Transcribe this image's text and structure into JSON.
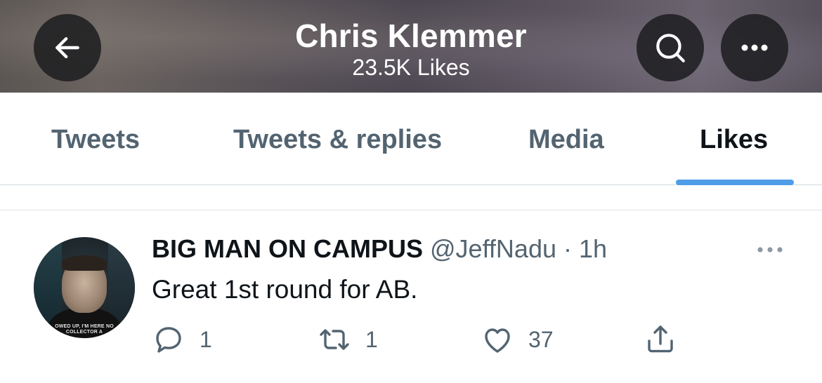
{
  "header": {
    "title": "Chris Klemmer",
    "subtitle": "23.5K Likes",
    "back_icon": "arrow-left-icon",
    "search_icon": "search-icon",
    "more_icon": "more-horizontal-icon"
  },
  "tabs": [
    {
      "label": "Tweets",
      "active": false
    },
    {
      "label": "Tweets & replies",
      "active": false
    },
    {
      "label": "Media",
      "active": false
    },
    {
      "label": "Likes",
      "active": true
    }
  ],
  "colors": {
    "accent": "#4f9de8",
    "primary_text": "#0f1419",
    "secondary_text": "#536471"
  },
  "tweet": {
    "display_name": "BIG MAN ON CAMPUS",
    "handle": "@JeffNadu",
    "separator": " · ",
    "time": "1h",
    "text": "Great 1st round for AB.",
    "avatar_caption_line1": "OWED UP, I'M HERE NO",
    "avatar_caption_line2": "COLLECTOR A",
    "actions": {
      "reply_count": "1",
      "retweet_count": "1",
      "like_count": "37"
    }
  }
}
